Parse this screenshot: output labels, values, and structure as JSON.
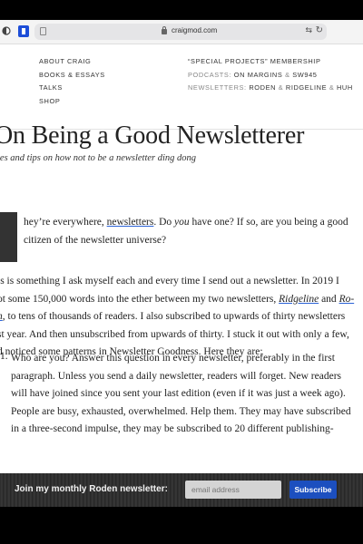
{
  "browser": {
    "url": "craigmod.com",
    "icons": [
      "sidebar-icon",
      "bookmark-icon",
      "page-icon",
      "lock-icon",
      "translate-icon",
      "reload-icon"
    ]
  },
  "nav": {
    "left": [
      "ABOUT CRAIG",
      "BOOKS & ESSAYS",
      "TALKS",
      "SHOP"
    ],
    "special": "“SPECIAL PROJECTS” MEMBERSHIP",
    "podcasts_label": "PODCASTS:",
    "podcasts": [
      "ON MARGINS",
      "SW945"
    ],
    "newsletters_label": "NEWSLETTERS:",
    "newsletters": [
      "RODEN",
      "RIDGELINE",
      "HUH"
    ],
    "amp": "&"
  },
  "article": {
    "title": "On Being a Good Newsletterer",
    "subtitle": "tes and tips on how not to be a newsletter ding dong",
    "p1": {
      "l1a": "hey’re everywhere, ",
      "l1link": "newsletters",
      "l1b": ". Do ",
      "l1em": "you",
      "l1c": " have one? If so, are you being a good",
      "l2": "citizen of the newsletter universe?"
    },
    "p2": {
      "l1": "is is something I ask myself each and every time I send out a newsletter. In 2019 I",
      "l2a": "ot some 150,000 words into the ether between my two newsletters, ",
      "l2link1": "Ridgeline",
      "l2b": " and ",
      "l2link2": "Ro-",
      "l3link": "n",
      "l3b": ", to tens of thousands of readers. I also subscribed to upwards of thirty newsletters",
      "l4": "st year. And then unsubscribed from upwards of thirty. I stuck it out with only a few,",
      "l5": "d noticed some patterns in Newsletter Goodness. Here they are:"
    },
    "list": {
      "marker": "1.",
      "l1": "Who are you? Answer this question in every newsletter, preferably in the first",
      "l2": "paragraph. Unless you send a daily newsletter, readers will forget. New readers",
      "l3": "will have joined since you sent your last edition (even if it was just a week ago).",
      "l4": "People are busy, exhausted, overwhelmed. Help them. They may have subscribed",
      "l5": "in a three-second impulse, they may be subscribed to 20 different publishing-"
    }
  },
  "newsletter_bar": {
    "label": "Join my monthly Roden newsletter:",
    "placeholder": "email address",
    "button": "Subscribe"
  },
  "colors": {
    "accent": "#1c4fbf",
    "link_underline": "#2b62d6",
    "text": "#222222"
  }
}
